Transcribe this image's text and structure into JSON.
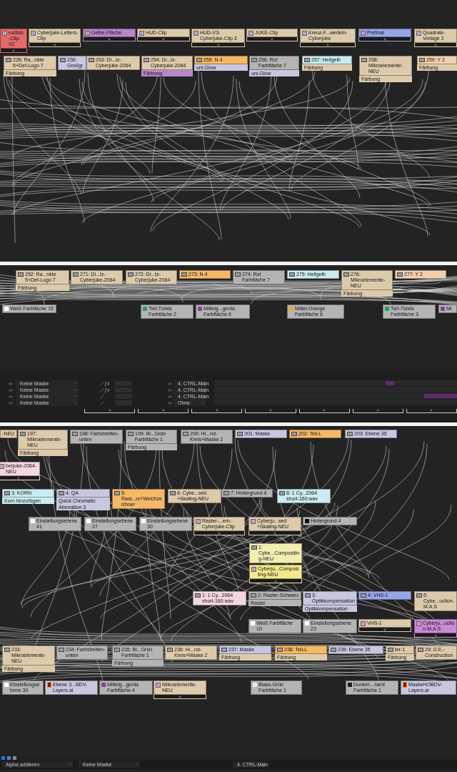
{
  "graph_top": {
    "nodes": [
      {
        "kind": "comp",
        "label": "ruction-Clip-V2",
        "color": "#e36b6b"
      },
      {
        "kind": "comp",
        "label": "Cyberjuke-Letters-Clip",
        "color": "#dccbab"
      },
      {
        "kind": "comp",
        "label": "Gelbe-Fläche",
        "color": "#b886c9"
      },
      {
        "kind": "comp",
        "label": "HUD-Clip",
        "color": "#dccbab"
      },
      {
        "kind": "comp",
        "label": "HUD-V3-Cyberjuke-Clip 3",
        "color": "#dccbab"
      },
      {
        "kind": "comp",
        "label": "JUKE-Clip",
        "color": "#dccbab"
      },
      {
        "kind": "comp",
        "label": "Kreuz-F...wedeln-Cyberjuke",
        "color": "#dccbab"
      },
      {
        "kind": "comp",
        "label": "Prefinal",
        "color": "#98a6e6"
      },
      {
        "kind": "comp",
        "label": "Quadrate-Vorlage 2",
        "color": "#dccbab"
      },
      {
        "kind": "layer",
        "label": "235: Ra...nkte 5+Def-Logo 7",
        "color": "#dccbab",
        "sub": {
          "text": "Färbung",
          "color": "#dccbab"
        }
      },
      {
        "kind": "layer",
        "label": "236: Großgr",
        "color": "#c7c7e0"
      },
      {
        "kind": "layer",
        "label": "253: Di...tz-Cyberjuke-2064",
        "color": "#dccbab"
      },
      {
        "kind": "layer",
        "label": "254: Di...tz-Cyberjuke-2064",
        "color": "#dccbab",
        "sub": {
          "text": "Färbung",
          "color": "#b886c9"
        }
      },
      {
        "kind": "layer",
        "label": "255: N 4",
        "color": "#f4b868",
        "sub": {
          "text": "uni.Glow",
          "color": "#c7c7e0"
        }
      },
      {
        "kind": "layer",
        "label": "256: Rot Farbfläche 7",
        "color": "#b4b4b4",
        "sub": {
          "text": "uni.Glow",
          "color": "#c7c7e0"
        }
      },
      {
        "kind": "layer",
        "label": "257: Hellgelb",
        "color": "#c8ecf0",
        "sub": {
          "text": "Färbung",
          "color": "#dccbab"
        }
      },
      {
        "kind": "layer",
        "label": "258: Mikroelemente-NEU",
        "color": "#dccbab",
        "sub": {
          "text": "Färbung",
          "color": "#dccbab"
        }
      },
      {
        "kind": "layer",
        "label": "259: Y 2",
        "color": "#f2cfae",
        "sub": {
          "text": "Färbung",
          "color": "#dccbab"
        }
      }
    ]
  },
  "graph_middle": {
    "nodes": [
      {
        "kind": "layer",
        "label": "252: Ra...nkte 5+Def-Logo 7",
        "color": "#dccbab",
        "sub": {
          "text": "Färbung",
          "color": "#dccbab"
        }
      },
      {
        "kind": "layer",
        "label": "271: Di...tz-Cyberjuke-2064",
        "color": "#dccbab"
      },
      {
        "kind": "layer",
        "label": "272: Di...tz-Cyberjuke-2064",
        "color": "#dccbab"
      },
      {
        "kind": "layer",
        "label": "273: N 4",
        "color": "#f4b868"
      },
      {
        "kind": "layer",
        "label": "274: Rot Farbfläche 7",
        "color": "#b4b4b4"
      },
      {
        "kind": "layer",
        "label": "275: Hellgelb",
        "color": "#c8ecf0"
      },
      {
        "kind": "layer",
        "label": "276: Mikroelemente-NEU",
        "color": "#dccbab",
        "sub": {
          "text": "Färbung",
          "color": "#dccbab"
        }
      },
      {
        "kind": "layer",
        "label": "277: Y 2",
        "color": "#f2cfae"
      },
      {
        "kind": "solid",
        "label": "Weiß Farbfläche 15",
        "color": "#ffffff"
      },
      {
        "kind": "solid",
        "label": "Tief-Türkis Farbfläche 2",
        "color": "#23a05a"
      },
      {
        "kind": "solid",
        "label": "Mittelg...genta Farbfläche 6",
        "color": "#8a3f9e"
      },
      {
        "kind": "solid",
        "label": "Mittel-Orange Farbfläche 6",
        "color": "#f0a82e"
      },
      {
        "kind": "solid",
        "label": "Tief-Türkis Farbfläche 3",
        "color": "#23a05a"
      },
      {
        "kind": "solid",
        "label": "Mi",
        "color": "#8a3f9e"
      }
    ]
  },
  "timeline": {
    "rows": [
      {
        "mask": "Keine Maske",
        "fx": "ƒx",
        "parent": "4. CTRL-Main",
        "clip": true
      },
      {
        "mask": "Keine Maske",
        "fx": "ƒx",
        "parent": "4. CTRL-Main",
        "clip": false
      },
      {
        "mask": "Keine Maske",
        "parent": "4. CTRL-Main",
        "clip": true
      },
      {
        "mask": "Keine Maske",
        "parent": "Ohne",
        "clip": false
      }
    ]
  },
  "graph_bottom": {
    "nodes": [
      {
        "kind": "fragment",
        "label": "-NEU",
        "color": "#dccbab"
      },
      {
        "kind": "layer",
        "label": "197: Mikroelemente-NEU",
        "color": "#dccbab",
        "sub": {
          "text": "Färbung",
          "color": "#dccbab"
        }
      },
      {
        "kind": "layer",
        "label": "198: Farbstreifen-unten",
        "color": "#b4b4b4"
      },
      {
        "kind": "layer",
        "label": "199: Bl...Grün Farbfläche 1",
        "color": "#b4b4b4",
        "sub": {
          "text": "Färbung",
          "color": "#b4b4b4"
        }
      },
      {
        "kind": "layer",
        "label": "200: Hi...nd-Kreis+Maske 2",
        "color": "#b4b4b4"
      },
      {
        "kind": "layer",
        "label": "201: Maske",
        "color": "#c7c7e0"
      },
      {
        "kind": "layer",
        "label": "202: Teil-L",
        "color": "#f4b868"
      },
      {
        "kind": "layer",
        "label": "203: Ebene 35",
        "color": "#c7c7e0"
      },
      {
        "kind": "comp",
        "label": "berjuke-2064-NEU",
        "color": "#f4d6e0"
      },
      {
        "kind": "layer",
        "label": "3: KORN",
        "color": "#c8ecf0",
        "sub": {
          "text": "Korn hinzufügen",
          "color": "#c8ecf0"
        }
      },
      {
        "kind": "layer",
        "label": "4: QA",
        "color": "#c7c7e0",
        "sub": {
          "text": "Quick Chromatic Aberration 3",
          "color": "#c7c7e0"
        }
      },
      {
        "kind": "layer",
        "label": "5: Rast...rz+Weichzeichner",
        "color": "#f4b868"
      },
      {
        "kind": "layer",
        "label": "6: Cybe...sed +Skaling-NEU",
        "color": "#dccbab"
      },
      {
        "kind": "layer",
        "label": "7: Hintergrund 4",
        "color": "#b4b4b4"
      },
      {
        "kind": "layer",
        "label": "8: 1 Cy...2064 short-160.wav",
        "color": "#c8ecf0"
      },
      {
        "kind": "solid",
        "label": "Einstellungsebene 41",
        "color": "#ffffff"
      },
      {
        "kind": "solid",
        "label": "Einstellungsebene 27",
        "color": "#ffffff"
      },
      {
        "kind": "solid",
        "label": "Einstellungsebene 30",
        "color": "#ffffff"
      },
      {
        "kind": "comp",
        "label": "Raster-...em-Cyberjuke-Clip",
        "color": "#dccbab"
      },
      {
        "kind": "comp",
        "label": "Cyberju...sed +Skaling-NEU",
        "color": "#dccbab"
      },
      {
        "kind": "solid",
        "label": "Hintergrund 4",
        "color": "#111111"
      },
      {
        "kind": "layer",
        "label": "1: Cybe...Compositing-NEU",
        "color": "#f3eeb0"
      },
      {
        "kind": "comp",
        "label": "Cyberju...Compositing-NEU",
        "color": "#f3e98c"
      },
      {
        "kind": "layer",
        "label": "1: 1 Cy...2064 short-160.wav",
        "color": "#f4d6e0"
      },
      {
        "kind": "layer",
        "label": "2: Raster-Schwarz",
        "color": "#b4b4b4",
        "sub": {
          "text": "Raster",
          "color": "#b4b4b4"
        }
      },
      {
        "kind": "layer",
        "label": "3: Optikkompensation",
        "color": "#c7c7e0",
        "sub": {
          "text": "Optikkompensation",
          "color": "#c7c7e0"
        }
      },
      {
        "kind": "layer",
        "label": "4: VHS-1",
        "color": "#98a6e6"
      },
      {
        "kind": "layer",
        "label": "5: Cybe...uction-M.A.S",
        "color": "#dccbab"
      },
      {
        "kind": "solid",
        "label": "Weiß Farbfläche 10",
        "color": "#ffffff"
      },
      {
        "kind": "solid",
        "label": "Einstellungsebene 23",
        "color": "#ffffff"
      },
      {
        "kind": "comp",
        "label": "VHS-1",
        "color": "#dccbab"
      },
      {
        "kind": "comp",
        "label": "Cyberju...uction-M.A.S",
        "color": "#c98ad6"
      },
      {
        "kind": "layer",
        "label": "233: Mikroelemente-NEU",
        "color": "#dccbab",
        "sub": {
          "text": "Färbung",
          "color": "#dccbab"
        }
      },
      {
        "kind": "layer",
        "label": "234: Farbstreifen-unten",
        "color": "#b4b4b4"
      },
      {
        "kind": "layer",
        "label": "235: Bl...Grün Farbfläche 1",
        "color": "#b4b4b4",
        "sub": {
          "text": "Färbung",
          "color": "#b4b4b4"
        }
      },
      {
        "kind": "layer",
        "label": "236: Hi...nd-Kreis+Maske 2",
        "color": "#dccbab"
      },
      {
        "kind": "layer",
        "label": "237: Maske",
        "color": "#c7c7e0",
        "sub": {
          "text": "Färbung",
          "color": "#dccbab"
        }
      },
      {
        "kind": "layer",
        "label": "238: Teil-L",
        "color": "#f4b868",
        "sub": {
          "text": "Färbung",
          "color": "#dccbab"
        }
      },
      {
        "kind": "layer",
        "label": "239: Ebene 35",
        "color": "#c7c7e0"
      },
      {
        "kind": "layer",
        "label": "ter-1",
        "color": "#dccbab",
        "sub": {
          "text": "Färbung",
          "color": "#dccbab"
        }
      },
      {
        "kind": "layer",
        "label": "29: D.E.-Construction",
        "color": "#dccbab"
      },
      {
        "kind": "solid",
        "label": "Einstellungsebene 30",
        "color": "#ffffff"
      },
      {
        "kind": "file",
        "label": "Ebene 3...BDV-Layers.ai",
        "color": "#c7c7e0"
      },
      {
        "kind": "solid",
        "label": "Mittelg...genta Farbfläche 4",
        "color": "#8a3f9e"
      },
      {
        "kind": "comp",
        "label": "Mikroelemente-NEU",
        "color": "#dccbab"
      },
      {
        "kind": "solid",
        "label": "Blass-Grün Farbfläche 1",
        "color": "#dff2df"
      },
      {
        "kind": "solid",
        "label": "Dunkel-...tarot Farbfläche 1",
        "color": "#2a1620"
      },
      {
        "kind": "file",
        "label": "MaskeHOBDV-Layers.ai",
        "color": "#c7c7e0"
      }
    ]
  },
  "footer": {
    "mode": "Alpha addieren",
    "mask": "Keine Maske",
    "parent": "4. CTRL-Main"
  }
}
